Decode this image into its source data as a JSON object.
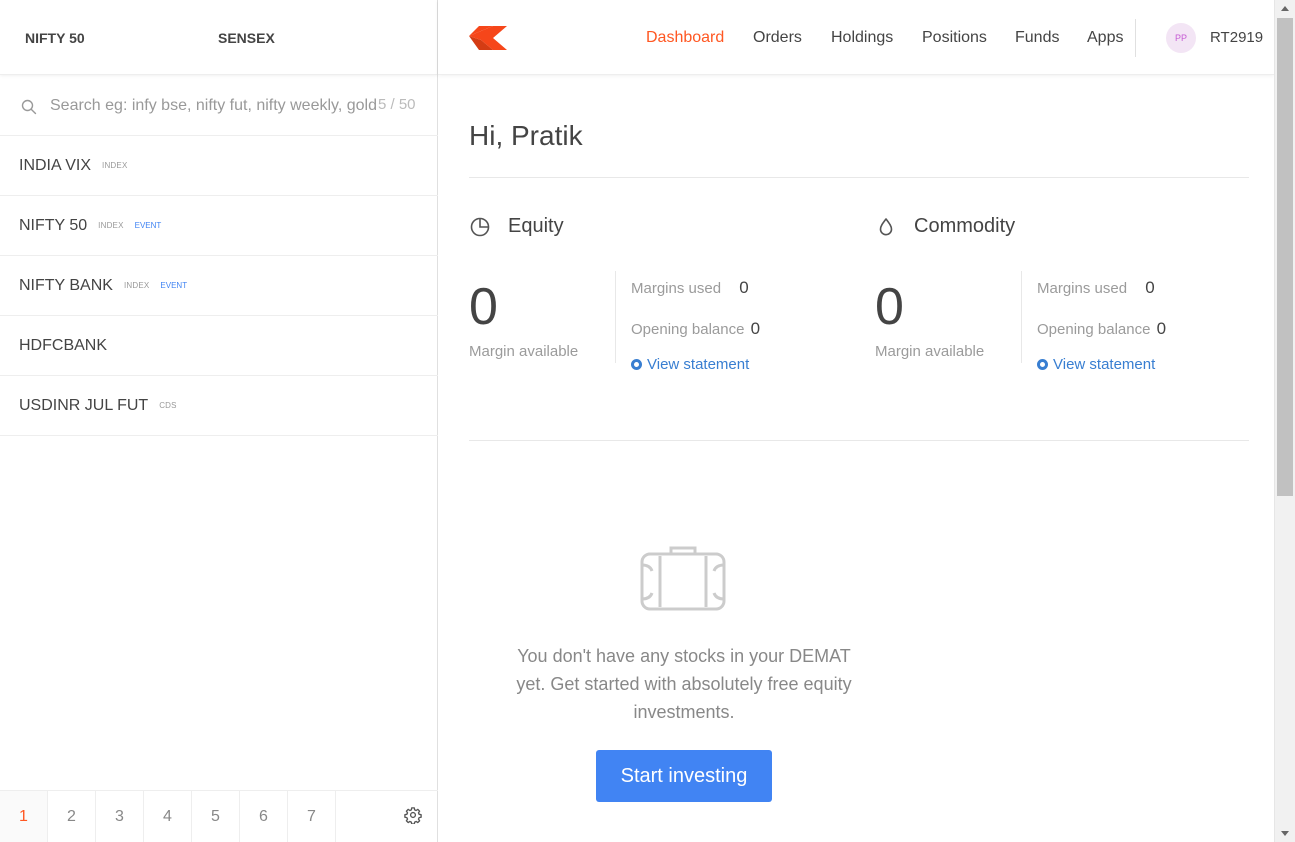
{
  "indices": {
    "first": "NIFTY 50",
    "second": "SENSEX"
  },
  "search": {
    "placeholder": "Search eg: infy bse, nifty fut, nifty weekly, gold mcx",
    "count": "5 / 50"
  },
  "watchlist": [
    {
      "name": "INDIA VIX",
      "tag": "INDEX",
      "event": ""
    },
    {
      "name": "NIFTY 50",
      "tag": "INDEX",
      "event": "EVENT"
    },
    {
      "name": "NIFTY BANK",
      "tag": "INDEX",
      "event": "EVENT"
    },
    {
      "name": "HDFCBANK",
      "tag": "",
      "event": ""
    },
    {
      "name": "USDINR JUL FUT",
      "tag": "CDS",
      "event": ""
    }
  ],
  "pager": {
    "tabs": [
      "1",
      "2",
      "3",
      "4",
      "5",
      "6",
      "7"
    ],
    "active": "1",
    "icon": "gear-icon"
  },
  "header": {
    "logo_icon": "kite-logo-icon",
    "nav": [
      "Dashboard",
      "Orders",
      "Holdings",
      "Positions",
      "Funds",
      "Apps"
    ],
    "active_nav": "Dashboard",
    "avatar_initials": "PP",
    "user_id": "RT2919"
  },
  "main": {
    "greeting": "Hi, Pratik",
    "equity": {
      "title": "Equity",
      "icon": "pie-chart-icon",
      "margin_available": "0",
      "margin_available_label": "Margin available",
      "margins_used_label": "Margins used",
      "margins_used": "0",
      "opening_balance_label": "Opening balance",
      "opening_balance": "0",
      "view_statement": "View statement"
    },
    "commodity": {
      "title": "Commodity",
      "icon": "drop-icon",
      "margin_available": "0",
      "margin_available_label": "Margin available",
      "margins_used_label": "Margins used",
      "margins_used": "0",
      "opening_balance_label": "Opening balance",
      "opening_balance": "0",
      "view_statement": "View statement"
    },
    "empty": {
      "icon": "briefcase-icon",
      "message": "You don't have any stocks in your DEMAT yet. Get started with absolutely free equity investments.",
      "button": "Start investing"
    }
  },
  "colors": {
    "accent": "#ff5722",
    "link": "#387ed1",
    "primary_button": "#4184f3",
    "event": "#4184f3"
  }
}
